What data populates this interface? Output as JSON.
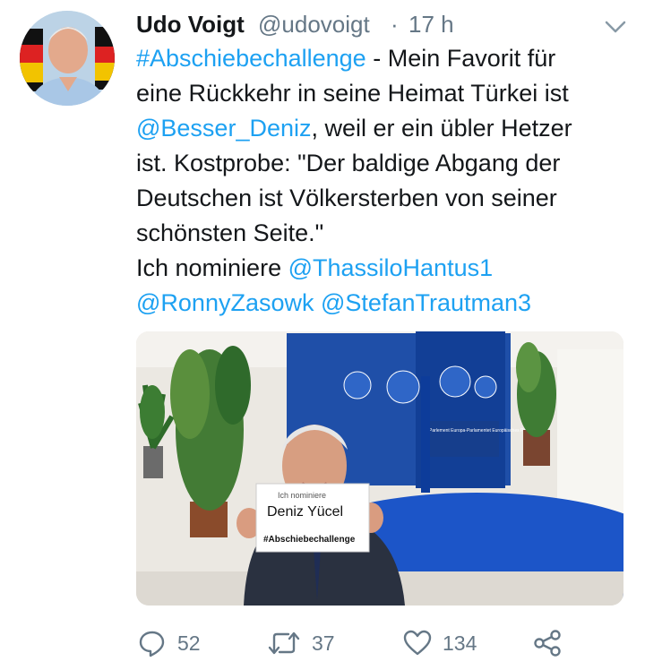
{
  "tweet": {
    "author": {
      "name": "Udo Voigt",
      "handle": "@udovoigt"
    },
    "separator": "·",
    "time": "17 h",
    "body": {
      "hashtag": "#Abschiebechallenge",
      "line1_rest": " - Mein Favorit für",
      "line2": "eine Rückkehr in seine Heimat Türkei ist",
      "mention1": "@Besser_Deniz",
      "line3_rest": ", weil er ein übler Hetzer",
      "line4": "ist. Kostprobe: \"Der baldige Abgang der",
      "line5": "Deutschen ist Völkersterben von seiner",
      "line6": "schönsten Seite.\"",
      "line7_prefix": "Ich nominiere ",
      "mention2": "@ThassiloHantus1",
      "mention3": "@RonnyZasowk",
      "mention4": "@StefanTrautman3"
    },
    "image": {
      "sign_line1": "Ich nominiere",
      "sign_line2": "Deniz Yücel",
      "sign_line3": "#Abschiebechallenge",
      "banner_text": "Parlement Europa-Parlamentet Europäisches Parlament"
    },
    "actions": {
      "replies": "52",
      "retweets": "37",
      "likes": "134"
    },
    "colors": {
      "link": "#1da1f2",
      "muted": "#657786",
      "text": "#14171a"
    }
  }
}
